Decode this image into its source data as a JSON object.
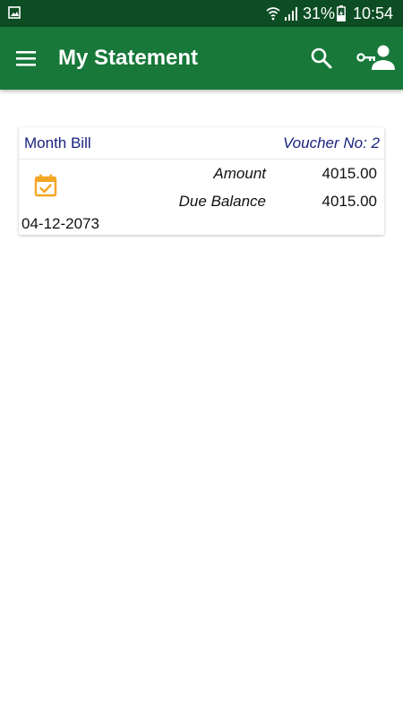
{
  "status_bar": {
    "battery_percent": "31%",
    "time": "10:54"
  },
  "app_bar": {
    "title": "My Statement",
    "icons": [
      "menu-icon",
      "search-icon",
      "user-key-icon"
    ]
  },
  "statement": {
    "bill_type": "Month Bill",
    "voucher": "Voucher No: 2",
    "amount_label": "Amount",
    "amount_value": "4015.00",
    "due_label": "Due Balance",
    "due_value": "4015.00",
    "date": "04-12-2073",
    "icon": "calendar-check-icon",
    "accent_color": "#f5a623"
  },
  "colors": {
    "status_bar": "#0d4d24",
    "app_bar": "#17783a",
    "link_text": "#1a237e"
  }
}
